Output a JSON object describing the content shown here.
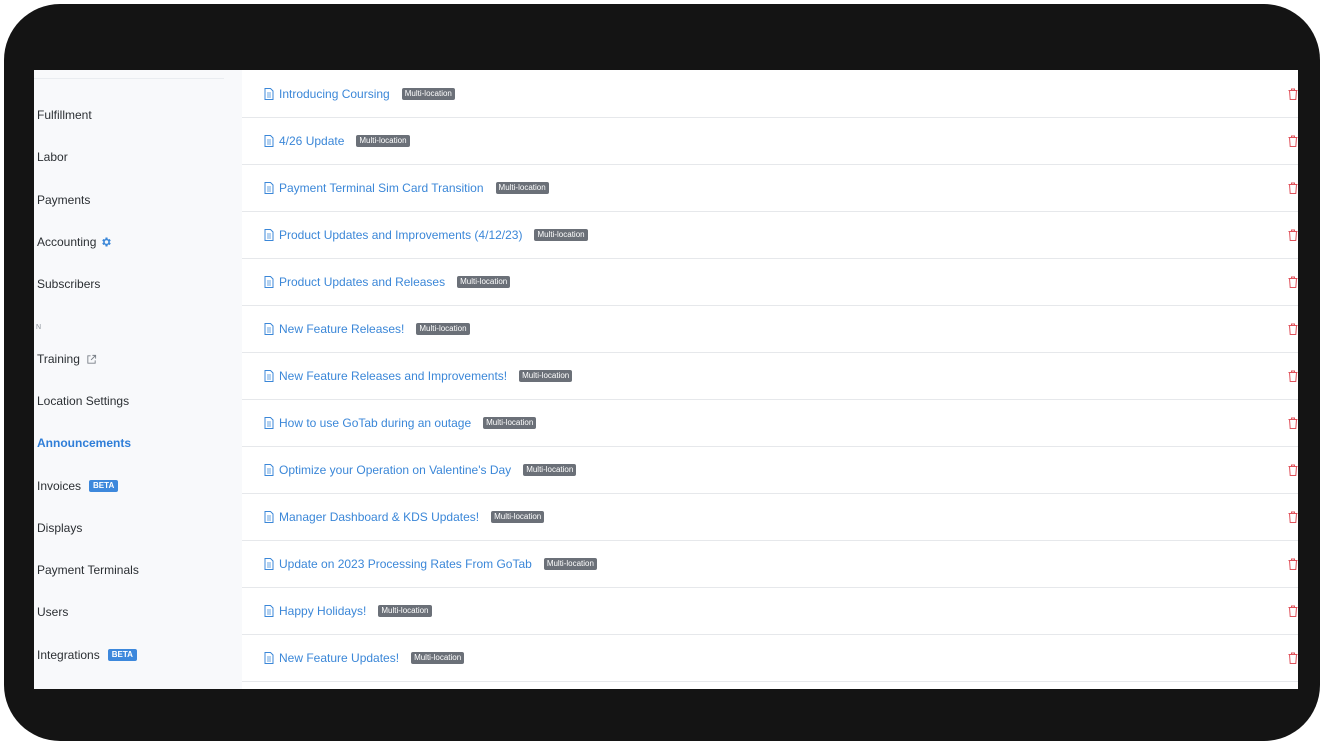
{
  "sidebar": {
    "items": [
      {
        "label": "Fulfillment"
      },
      {
        "label": "Labor"
      },
      {
        "label": "Payments"
      },
      {
        "label": "Accounting"
      },
      {
        "label": "Subscribers"
      },
      {
        "label": "Training"
      },
      {
        "label": "Location Settings"
      },
      {
        "label": "Announcements"
      },
      {
        "label": "Invoices",
        "badge": "BETA"
      },
      {
        "label": "Displays"
      },
      {
        "label": "Payment Terminals"
      },
      {
        "label": "Users"
      },
      {
        "label": "Integrations",
        "badge": "BETA"
      }
    ],
    "section_label": "N"
  },
  "announcements": [
    {
      "title": "Introducing Coursing",
      "badge": "Multi-location"
    },
    {
      "title": "4/26 Update",
      "badge": "Multi-location"
    },
    {
      "title": "Payment Terminal Sim Card Transition",
      "badge": "Multi-location"
    },
    {
      "title": "Product Updates and Improvements (4/12/23)",
      "badge": "Multi-location"
    },
    {
      "title": "Product Updates and Releases",
      "badge": "Multi-location"
    },
    {
      "title": "New Feature Releases!",
      "badge": "Multi-location"
    },
    {
      "title": "New Feature Releases and Improvements!",
      "badge": "Multi-location"
    },
    {
      "title": "How to use GoTab during an outage",
      "badge": "Multi-location"
    },
    {
      "title": "Optimize your Operation on Valentine's Day",
      "badge": "Multi-location"
    },
    {
      "title": "Manager Dashboard & KDS Updates!",
      "badge": "Multi-location"
    },
    {
      "title": "Update on 2023 Processing Rates From GoTab",
      "badge": "Multi-location"
    },
    {
      "title": "Happy Holidays!",
      "badge": "Multi-location"
    },
    {
      "title": "New Feature Updates!",
      "badge": "Multi-location"
    }
  ],
  "icons": {
    "row_icon": "document-icon",
    "delete_icon": "trash-icon",
    "accounting_icon": "gear-icon",
    "training_icon": "external-link-icon"
  },
  "colors": {
    "accent": "#3b87d8",
    "badge_bg": "#6b7078",
    "beta_bg": "#3d88dc",
    "delete": "#e0525b",
    "frame": "#141414"
  }
}
